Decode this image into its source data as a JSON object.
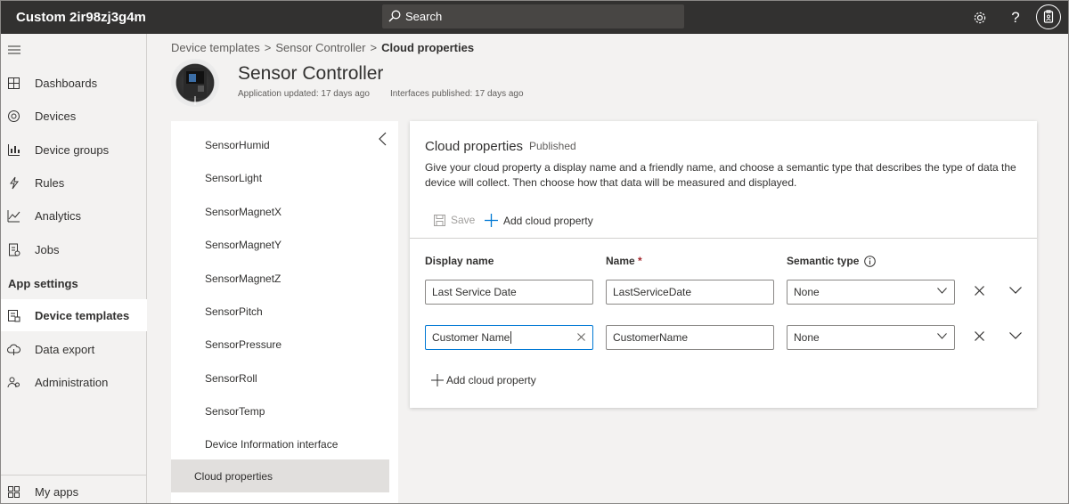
{
  "app": {
    "title": "Custom 2ir98zj3g4m"
  },
  "search": {
    "label": "Search"
  },
  "topbar": {
    "icons": [
      "settings-icon",
      "help-icon",
      "avatar"
    ]
  },
  "sidebar": {
    "items": [
      {
        "label": "Dashboards",
        "icon": "dashboard-icon"
      },
      {
        "label": "Devices",
        "icon": "devices-icon"
      },
      {
        "label": "Device groups",
        "icon": "device-groups-icon"
      },
      {
        "label": "Rules",
        "icon": "rules-icon"
      },
      {
        "label": "Analytics",
        "icon": "analytics-icon"
      },
      {
        "label": "Jobs",
        "icon": "jobs-icon"
      }
    ],
    "section_heading": "App settings",
    "settings_items": [
      {
        "label": "Device templates",
        "icon": "device-templates-icon",
        "active": true
      },
      {
        "label": "Data export",
        "icon": "data-export-icon"
      },
      {
        "label": "Administration",
        "icon": "administration-icon"
      }
    ],
    "bottom_item": {
      "label": "My apps",
      "icon": "my-apps-icon"
    }
  },
  "breadcrumb": {
    "items": [
      "Device templates",
      "Sensor Controller"
    ],
    "current": "Cloud properties",
    "separator": ">"
  },
  "header": {
    "title": "Sensor Controller",
    "app_updated": "Application updated: 17 days ago",
    "interfaces_published": "Interfaces published: 17 days ago"
  },
  "interfaces": {
    "items": [
      "SensorHumid",
      "SensorLight",
      "SensorMagnetX",
      "SensorMagnetY",
      "SensorMagnetZ",
      "SensorPitch",
      "SensorPressure",
      "SensorRoll",
      "SensorTemp",
      "Device Information interface"
    ],
    "active": "Cloud properties"
  },
  "card": {
    "title": "Cloud properties",
    "status": "Published",
    "description": "Give your cloud property a display name and a friendly name, and choose a semantic type that describes the type of data the device will collect. Then choose how that data will be measured and displayed.",
    "save_label": "Save",
    "add_label": "Add cloud property",
    "columns": {
      "display_name": "Display name",
      "name": "Name",
      "required_mark": "*",
      "semantic_type": "Semantic type"
    },
    "rows": [
      {
        "display_name": "Last Service Date",
        "name": "LastServiceDate",
        "semantic_type": "None"
      },
      {
        "display_name": "Customer Name",
        "name": "CustomerName",
        "semantic_type": "None"
      }
    ],
    "add_bottom_label": "Add cloud property"
  },
  "colors": {
    "accent": "#0078d4",
    "topbar": "#323130",
    "required": "#a4262c"
  }
}
